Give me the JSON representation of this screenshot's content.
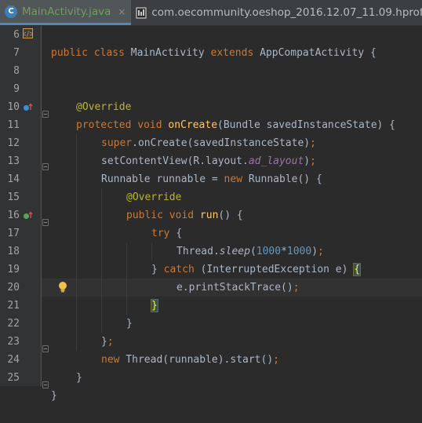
{
  "tabs": [
    {
      "label": "MainActivity.java",
      "icon": "java-class-icon",
      "active": true,
      "close": "×"
    },
    {
      "label": "com.oecommunity.oeshop_2016.12.07_11.09.hprof",
      "icon": "hprof-file-icon",
      "active": false
    }
  ],
  "editor": {
    "caret_line": 20,
    "lines": [
      {
        "n": "6"
      },
      {
        "n": "7"
      },
      {
        "n": "8"
      },
      {
        "n": "9"
      },
      {
        "n": "10"
      },
      {
        "n": "11"
      },
      {
        "n": "12"
      },
      {
        "n": "13"
      },
      {
        "n": "14"
      },
      {
        "n": "15"
      },
      {
        "n": "16"
      },
      {
        "n": "17"
      },
      {
        "n": "18"
      },
      {
        "n": "19"
      },
      {
        "n": "20"
      },
      {
        "n": "21"
      },
      {
        "n": "22"
      },
      {
        "n": "23"
      },
      {
        "n": "24"
      },
      {
        "n": "25"
      }
    ]
  },
  "code": {
    "l6": {
      "kw1": "public class ",
      "name": "MainActivity ",
      "kw2": "extends ",
      "parent": "AppCompatActivity ",
      "brace": "{"
    },
    "l9": {
      "ann": "@Override"
    },
    "l10": {
      "kw": "protected void ",
      "fn": "onCreate",
      "rest": "(Bundle savedInstanceState) {"
    },
    "l11": {
      "kw": "super",
      "dot": ".",
      "rest": "onCreate(savedInstanceState)",
      "semi": ";"
    },
    "l12": {
      "a": "setContentView(R.layout.",
      "fld": "ad_layout",
      "b": ")",
      "semi": ";"
    },
    "l13": {
      "a": "Runnable runnable = ",
      "kw": "new ",
      "b": "Runnable() {"
    },
    "l14": {
      "ann": "@Override"
    },
    "l15": {
      "kw": "public void ",
      "fn": "run",
      "rest": "() {"
    },
    "l16": {
      "kw": "try ",
      "rest": "{"
    },
    "l17": {
      "a": "Thread.",
      "ital": "sleep",
      "b": "(",
      "n1": "1000",
      "op": "*",
      "n2": "1000",
      "c": ")",
      "semi": ";"
    },
    "l18": {
      "a": "} ",
      "kw": "catch ",
      "b": "(InterruptedException e) ",
      "brace": "{"
    },
    "l19": {
      "a": "e.printStackTrace()",
      "semi": ";"
    },
    "l20": {
      "brace": "}"
    },
    "l21": {
      "a": "}"
    },
    "l22": {
      "a": "}",
      "semi": ";"
    },
    "l23": {
      "kw": "new ",
      "a": "Thread(runnable).start()",
      "semi": ";"
    },
    "l24": {
      "a": "}"
    },
    "l25": {
      "a": "}"
    }
  },
  "colors": {
    "background": "#2b2b2b",
    "gutter": "#313335",
    "keyword": "#cc7832",
    "annotation": "#bbb529",
    "method": "#ffc66d",
    "field": "#9876aa",
    "number": "#6897bb",
    "text": "#a9b7c6",
    "active_tab_text": "#6e9f5d"
  }
}
